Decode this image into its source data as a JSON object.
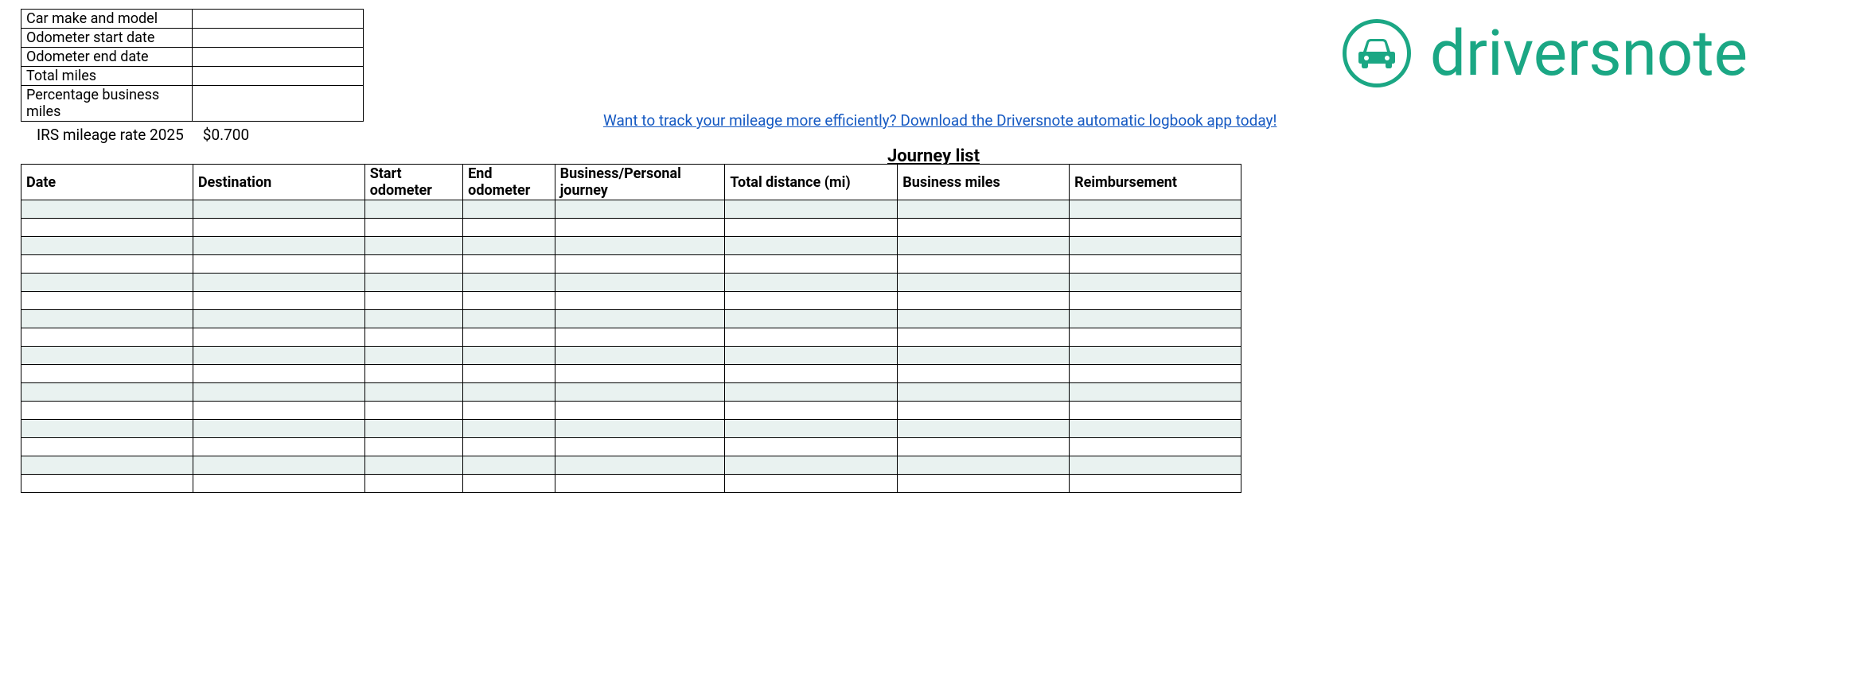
{
  "info_table": {
    "rows": [
      {
        "label": "Car make and model",
        "value": ""
      },
      {
        "label": "Odometer start date",
        "value": ""
      },
      {
        "label": "Odometer end date",
        "value": ""
      },
      {
        "label": "Total miles",
        "value": ""
      },
      {
        "label": "Percentage business miles",
        "value": ""
      }
    ]
  },
  "rate": {
    "label": "IRS mileage rate 2025",
    "value": "$0.700"
  },
  "logo": {
    "brand": "driversnote"
  },
  "promo": {
    "text": "Want to track your mileage more efficiently? Download the Driversnote automatic logbook app today!"
  },
  "journey": {
    "title": "Journey list",
    "headers": {
      "date": "Date",
      "destination": "Destination",
      "start_odometer": "Start odometer",
      "end_odometer": "End odometer",
      "business_personal": "Business/Personal journey",
      "total_distance": "Total distance (mi)",
      "business_miles": "Business miles",
      "reimbursement": "Reimbursement"
    },
    "row_count": 16
  }
}
